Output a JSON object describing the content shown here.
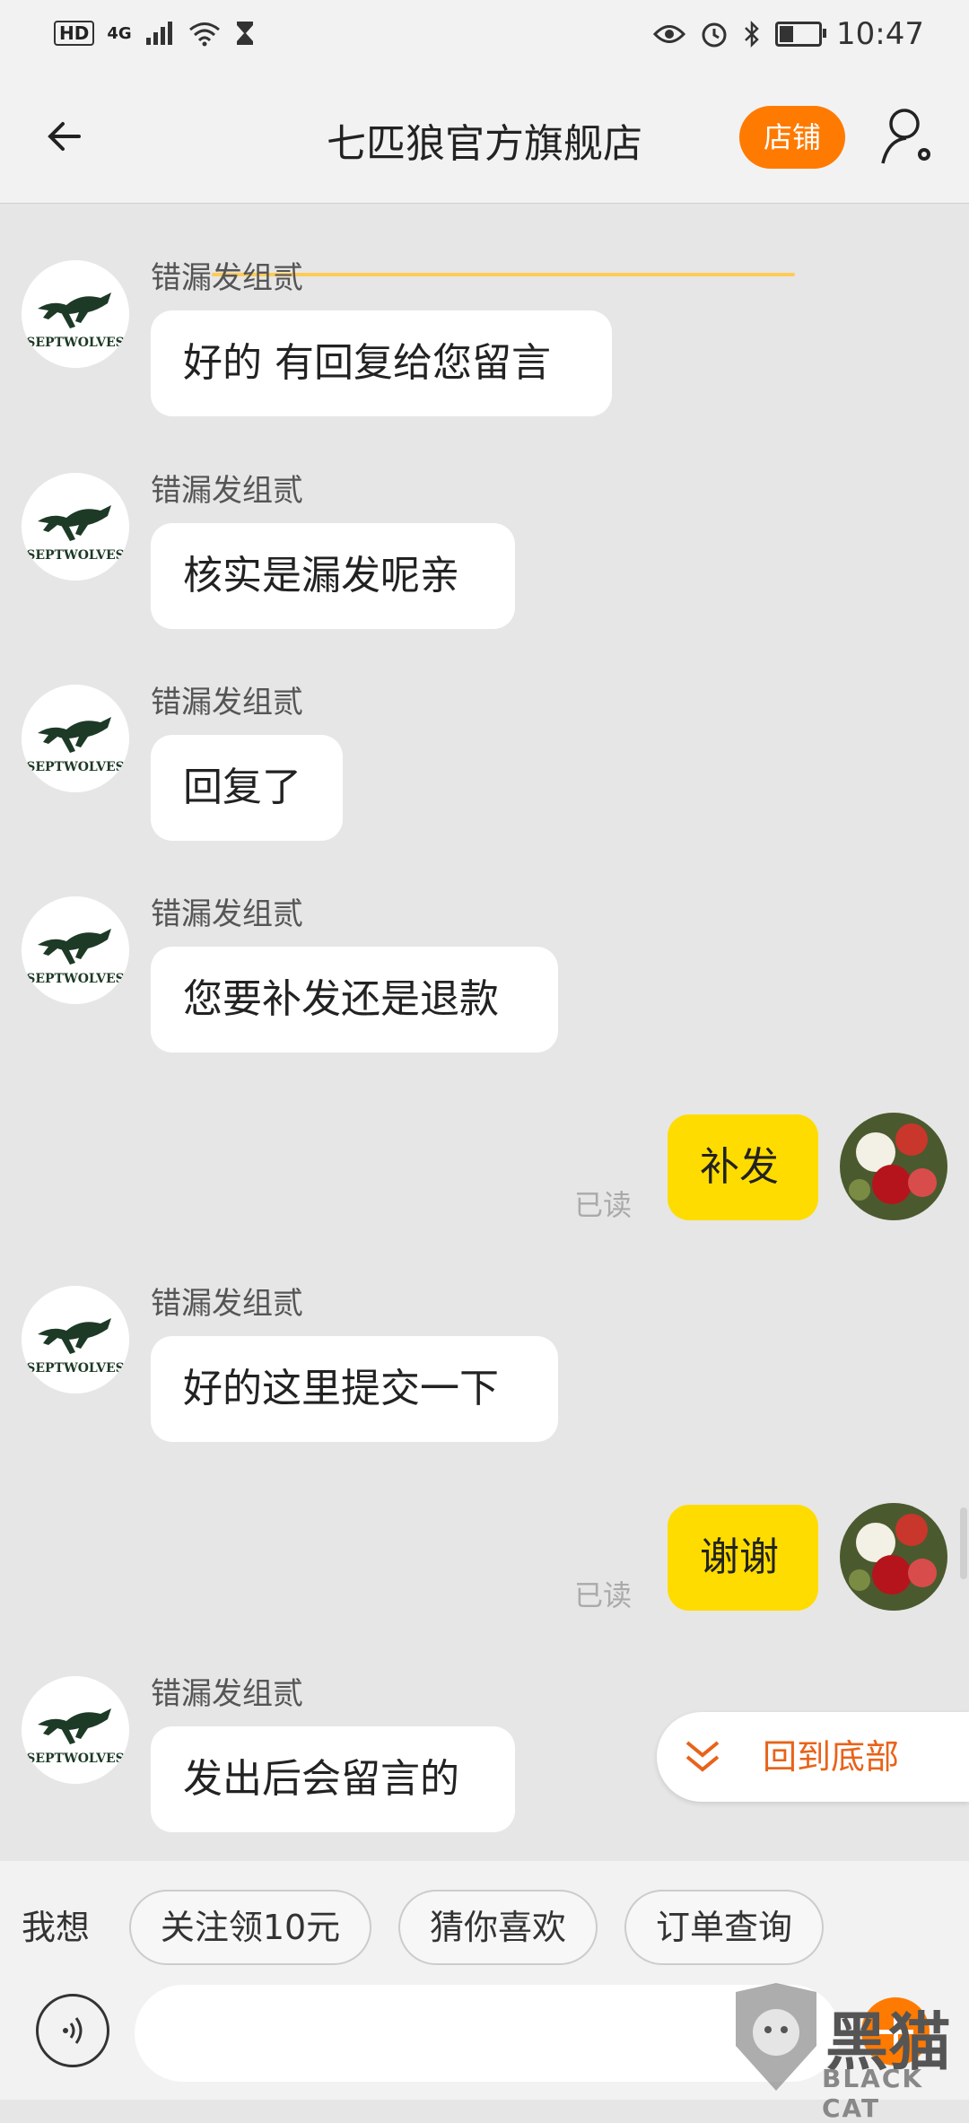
{
  "status_bar": {
    "left": {
      "hd": "HD",
      "network": "4G"
    },
    "right": {
      "time": "10:47",
      "battery_level": 0.35
    },
    "icons": [
      "signal-icon",
      "wifi-icon",
      "hourglass-icon",
      "eye-icon",
      "alarm-icon",
      "bluetooth-icon",
      "battery-icon"
    ]
  },
  "header": {
    "title": "七匹狼官方旗舰店",
    "shop_button": "店铺",
    "accent": "#ff7a00"
  },
  "messages": [
    {
      "from": "shop",
      "sender": "错漏发组贰",
      "text": "好的 有回复给您留言"
    },
    {
      "from": "shop",
      "sender": "错漏发组贰",
      "text": "核实是漏发呢亲"
    },
    {
      "from": "shop",
      "sender": "错漏发组贰",
      "text": "回复了"
    },
    {
      "from": "shop",
      "sender": "错漏发组贰",
      "text": "您要补发还是退款"
    },
    {
      "from": "me",
      "text": "补发",
      "status": "已读"
    },
    {
      "from": "shop",
      "sender": "错漏发组贰",
      "text": "好的这里提交一下"
    },
    {
      "from": "me",
      "text": "谢谢",
      "status": "已读"
    },
    {
      "from": "shop",
      "sender": "错漏发组贰",
      "text": "发出后会留言的"
    }
  ],
  "shop_avatar_logo": "SEPTWOLVES",
  "scroll_to_bottom": "回到底部",
  "bottom": {
    "prompt": "我想",
    "chips": [
      "关注领10元",
      "猜你喜欢",
      "订单查询"
    ],
    "input_placeholder": ""
  },
  "watermark": {
    "cn": "黑猫",
    "en": "BLACK CAT"
  },
  "colors": {
    "my_bubble": "#ffdc00",
    "scroll_label": "#e8631a",
    "background": "#e6e6e6"
  }
}
